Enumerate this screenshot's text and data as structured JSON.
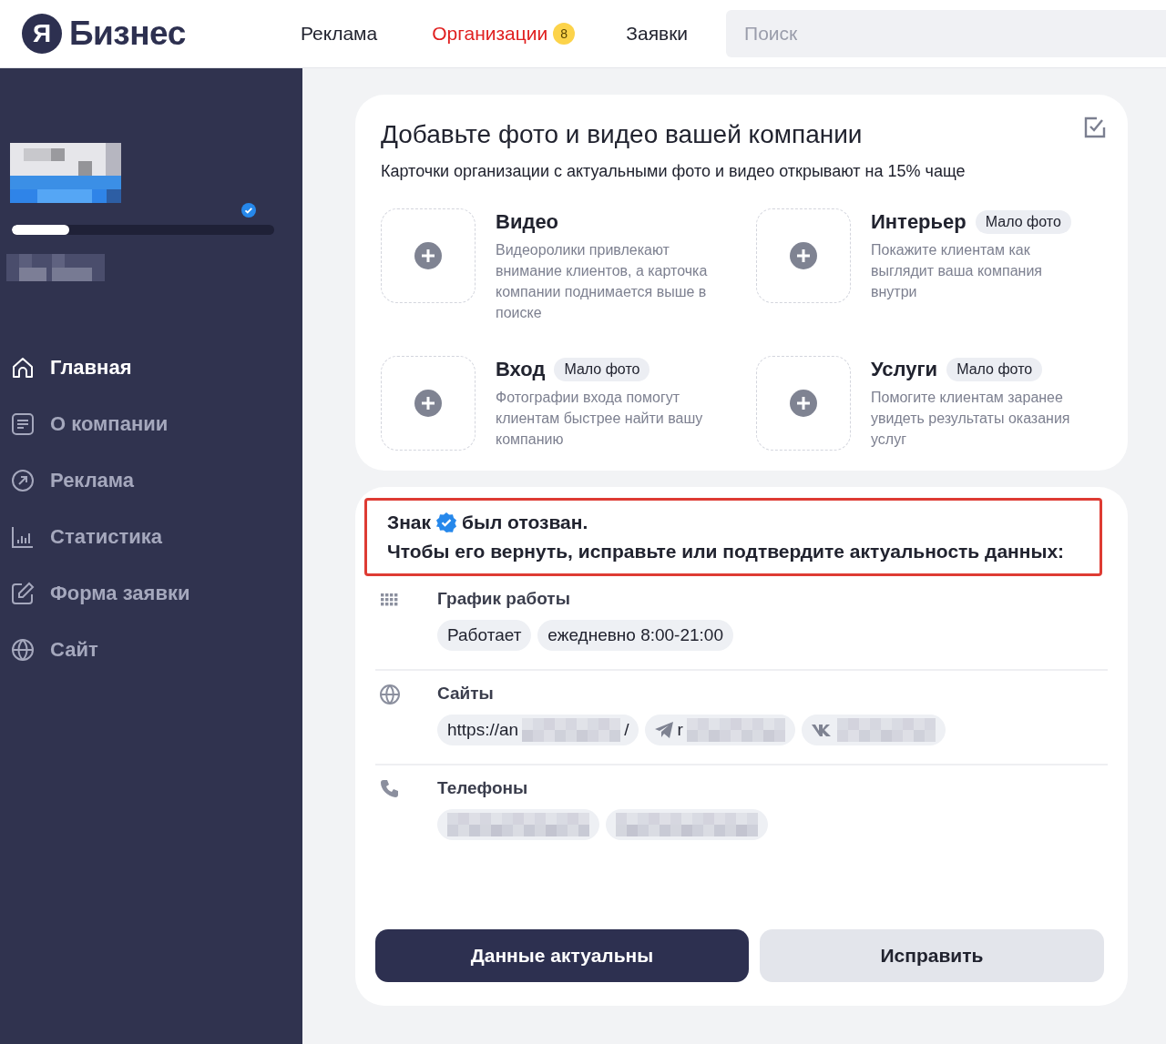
{
  "header": {
    "logo": {
      "letter": "Я",
      "text": "Бизнес"
    },
    "nav": [
      {
        "label": "Реклама",
        "selected": false
      },
      {
        "label": "Организации",
        "selected": true,
        "badge": "8"
      },
      {
        "label": "Заявки",
        "selected": false
      }
    ],
    "search": {
      "placeholder": "Поиск"
    }
  },
  "sidebar": {
    "profile": {
      "verified": true,
      "progress": {
        "level": 0.22
      }
    },
    "items": [
      {
        "label": "Главная",
        "selected": true
      },
      {
        "label": "О компании",
        "selected": false
      },
      {
        "label": "Реклама",
        "selected": false
      },
      {
        "label": "Статистика",
        "selected": false
      },
      {
        "label": "Форма заявки",
        "selected": false
      },
      {
        "label": "Сайт",
        "selected": false
      }
    ]
  },
  "photo_card": {
    "title": "Добавьте фото и видео вашей компании",
    "subtitle": "Карточки организации с актуальными фото и видео открывают на 15% чаще",
    "tiles": [
      {
        "title": "Видео",
        "description": "Видеоролики привлекают внимание клиентов, а карточка компании поднимается выше в поиске"
      },
      {
        "title": "Интерьер",
        "badge": "Мало фото",
        "description": "Покажите клиентам как выглядит ваша компания внутри"
      },
      {
        "title": "Вход",
        "badge": "Мало фото",
        "description": "Фотографии входа помогут клиентам быстрее найти вашу компанию"
      },
      {
        "title": "Услуги",
        "badge": "Мало фото",
        "description": "Помогите клиентам заранее увидеть результаты оказания услуг"
      }
    ]
  },
  "verify_card": {
    "notice": {
      "highlighted": true,
      "before_icon": "Знак",
      "after_icon": "был отозван.",
      "line2": "Чтобы его вернуть, исправьте или подтвердите актуальность данных:"
    },
    "sections": [
      {
        "label": "График работы",
        "chips": [
          {
            "kind": "text",
            "text": "Работает"
          },
          {
            "kind": "text",
            "text": "ежедневно 8:00-21:00"
          }
        ]
      },
      {
        "label": "Сайты",
        "chips": [
          {
            "kind": "link",
            "start": "https://an",
            "end": "/"
          },
          {
            "kind": "telegram",
            "start": "r"
          },
          {
            "kind": "vk"
          }
        ]
      },
      {
        "label": "Телефоны",
        "chips": [
          {
            "kind": "redacted"
          },
          {
            "kind": "redacted"
          }
        ]
      }
    ],
    "buttons": [
      {
        "label": "Данные актуальны",
        "primary": true
      },
      {
        "label": "Исправить",
        "primary": false
      }
    ]
  }
}
